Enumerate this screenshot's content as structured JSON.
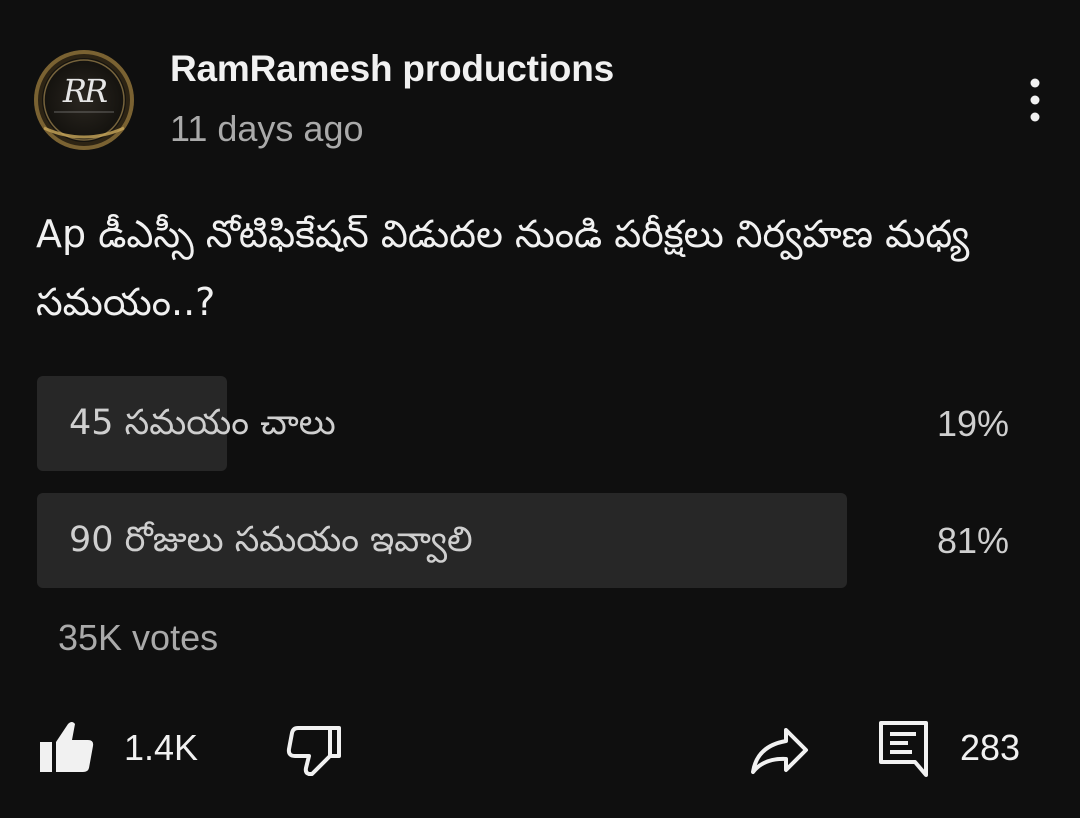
{
  "post": {
    "channel_name": "RamRamesh productions",
    "time_ago": "11 days ago",
    "avatar_text": "RR",
    "question": "Ap డీఎస్సీ నోటిఫికేషన్ విడుదల నుండి పరీక్షలు నిర్వహణ మధ్య సమయం..?"
  },
  "poll": {
    "options": [
      {
        "label": "45 సమయం చాలు",
        "percent_text": "19%",
        "percent": 19
      },
      {
        "label": "90 రోజులు సమయం ఇవ్వాలి",
        "percent_text": "81%",
        "percent": 81
      }
    ],
    "votes": "35K votes"
  },
  "actions": {
    "like_count": "1.4K",
    "comment_count": "283"
  },
  "icons": {
    "like": "thumbs-up-icon",
    "dislike": "thumbs-down-icon",
    "share": "share-icon",
    "comment": "comment-icon",
    "more": "more-vertical-icon"
  },
  "colors": {
    "background": "#0f0f0f",
    "poll_fill": "#272727",
    "primary_text": "#f1f1f1",
    "secondary_text": "#aaaaaa"
  }
}
